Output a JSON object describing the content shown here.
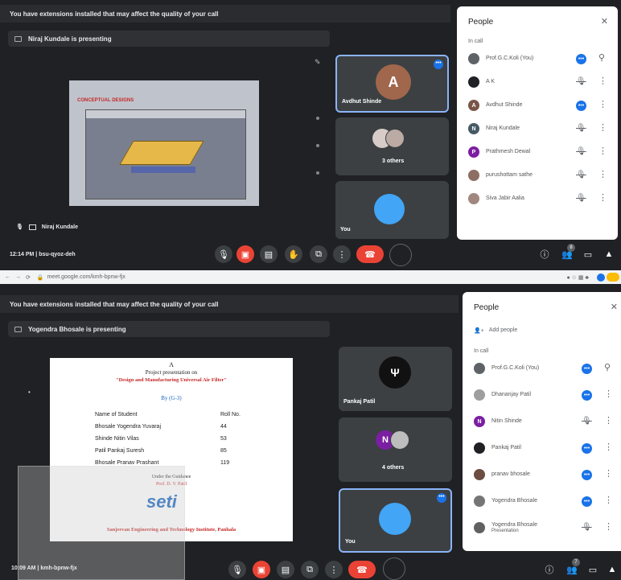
{
  "top": {
    "banner": "You have extensions installed that may affect the quality of your call",
    "presenting": "Niraj Kundale is presenting",
    "slide_title": "CONCEPTUAL DESIGNS",
    "tile1_avatar_letter": "A",
    "tile1_name": "Avdhut Shinde",
    "tile2_name": "3 others",
    "tile3_name": "You",
    "bottom_name": "Niraj Kundale",
    "time_code": "12:14 PM | bsu-qyoz-deh",
    "participant_badge": "8",
    "people_panel": {
      "title": "People",
      "section": "In call",
      "participants": [
        {
          "name": "Prof.G.C.Koli (You)",
          "color": "#5f6368",
          "initial": ""
        },
        {
          "name": "A K",
          "color": "#202124",
          "initial": ""
        },
        {
          "name": "Avdhut Shinde",
          "color": "#795548",
          "initial": "A"
        },
        {
          "name": "Niraj Kundale",
          "color": "#455a64",
          "initial": "N"
        },
        {
          "name": "Prathmesh Dewal",
          "color": "#7b1fa2",
          "initial": "P"
        },
        {
          "name": "purushottam sathe",
          "color": "#8d6e63",
          "initial": ""
        },
        {
          "name": "Siva Jabir Aalia",
          "color": "#a1887f",
          "initial": ""
        }
      ]
    }
  },
  "browser": {
    "url": "meet.google.com/kmh-bpnw-fjx"
  },
  "bottom": {
    "banner": "You have extensions installed that may affect the quality of your call",
    "presenting": "Yogendra Bhosale is presenting",
    "slide": {
      "letter": "A",
      "line1": "Project presentation on",
      "line2": "\"Design and Manufacturing Universal Air Filter\"",
      "by": "By (G-3)",
      "col1": "Name of Student",
      "col2": "Roll No.",
      "students": [
        {
          "name": "Bhosale Yogendra Yuvaraj",
          "roll": "44"
        },
        {
          "name": "Shinde Nitin Vilas",
          "roll": "53"
        },
        {
          "name": "Patil Pankaj Suresh",
          "roll": "85"
        },
        {
          "name": "Bhosale Pranav Prashant",
          "roll": "119"
        }
      ],
      "guidance": "Under the Guidance",
      "guide": "Prof. D. V. Patil",
      "logo": "seti",
      "footer": "Sanjeevan Engineering and Technology Institute, Panhala"
    },
    "tile1_name": "Pankaj Patil",
    "tile2_letter": "N",
    "tile2_name": "4 others",
    "tile3_name": "You",
    "time_code": "10:09 AM | kmh-bpnw-fjx",
    "participant_badge": "7",
    "people_panel": {
      "title": "People",
      "add": "Add people",
      "section": "In call",
      "participants": [
        {
          "name": "Prof.G.C.Koli (You)",
          "color": "#5f6368",
          "initial": ""
        },
        {
          "name": "Dhananjay Patil",
          "color": "#9e9e9e",
          "initial": ""
        },
        {
          "name": "Nitin Shinde",
          "color": "#7b1fa2",
          "initial": "N"
        },
        {
          "name": "Pankaj Patil",
          "color": "#202124",
          "initial": ""
        },
        {
          "name": "pranav bhosale",
          "color": "#6d4c41",
          "initial": ""
        },
        {
          "name": "Yogendra Bhosale",
          "color": "#757575",
          "initial": ""
        },
        {
          "name": "Yogendra Bhosale",
          "sub": "Presentation",
          "color": "#616161",
          "initial": ""
        }
      ]
    }
  }
}
